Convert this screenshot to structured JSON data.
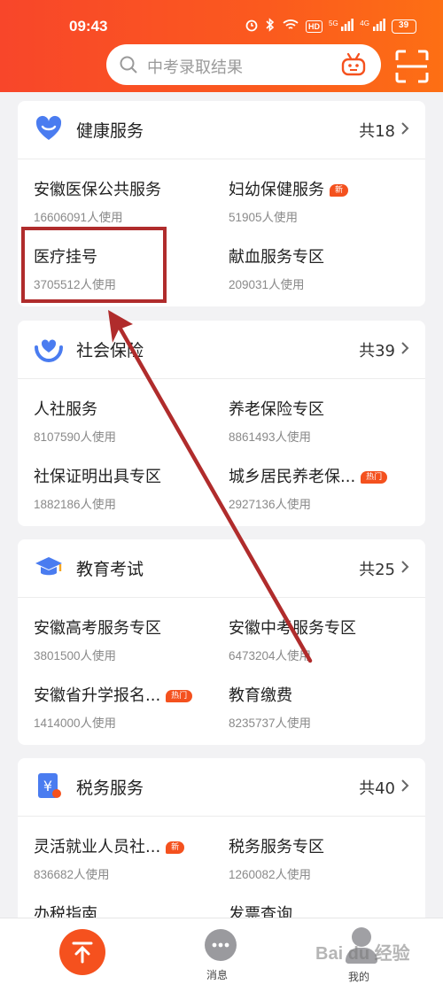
{
  "status_bar": {
    "time": "09:43",
    "hd": "HD",
    "net1": "5G",
    "net2": "4G",
    "battery": "39"
  },
  "search": {
    "placeholder": "中考录取结果"
  },
  "categories": [
    {
      "title": "健康服务",
      "count": "共18",
      "items": [
        {
          "name": "安徽医保公共服务",
          "usage": "16606091人使用",
          "tag": ""
        },
        {
          "name": "妇幼保健服务",
          "usage": "51905人使用",
          "tag": "新"
        },
        {
          "name": "医疗挂号",
          "usage": "3705512人使用",
          "tag": ""
        },
        {
          "name": "献血服务专区",
          "usage": "209031人使用",
          "tag": ""
        }
      ]
    },
    {
      "title": "社会保险",
      "count": "共39",
      "items": [
        {
          "name": "人社服务",
          "usage": "8107590人使用",
          "tag": ""
        },
        {
          "name": "养老保险专区",
          "usage": "8861493人使用",
          "tag": ""
        },
        {
          "name": "社保证明出具专区",
          "usage": "1882186人使用",
          "tag": ""
        },
        {
          "name": "城乡居民养老保...",
          "usage": "2927136人使用",
          "tag": "热门"
        }
      ]
    },
    {
      "title": "教育考试",
      "count": "共25",
      "items": [
        {
          "name": "安徽高考服务专区",
          "usage": "3801500人使用",
          "tag": ""
        },
        {
          "name": "安徽中考服务专区",
          "usage": "6473204人使用",
          "tag": ""
        },
        {
          "name": "安徽省升学报名...",
          "usage": "1414000人使用",
          "tag": "热门"
        },
        {
          "name": "教育缴费",
          "usage": "8235737人使用",
          "tag": ""
        }
      ]
    },
    {
      "title": "税务服务",
      "count": "共40",
      "items": [
        {
          "name": "灵活就业人员社...",
          "usage": "836682人使用",
          "tag": "新"
        },
        {
          "name": "税务服务专区",
          "usage": "1260082人使用",
          "tag": ""
        },
        {
          "name": "办税指南",
          "usage": "",
          "tag": ""
        },
        {
          "name": "发票查询",
          "usage": "",
          "tag": ""
        }
      ]
    }
  ],
  "bottom_nav": {
    "home_icon": "up-arrow-icon",
    "messages_label": "消息",
    "me_label": "我的"
  },
  "watermark": "Bai du 经验",
  "colors": {
    "accent": "#f5511e",
    "annotation": "#b02c2c"
  }
}
